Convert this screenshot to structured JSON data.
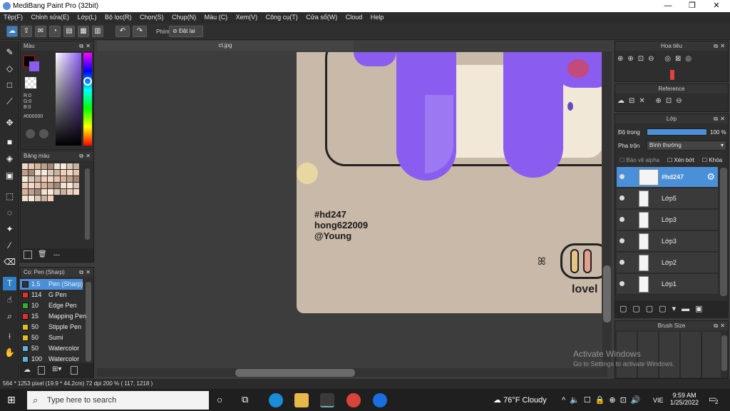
{
  "window": {
    "title": "MediBang Paint Pro (32bit)",
    "min": "—",
    "max": "❐",
    "close": "✕"
  },
  "menu": [
    "Tệp(F)",
    "Chỉnh sửa(E)",
    "Lớp(L)",
    "Bộ lọc(R)",
    "Chọn(S)",
    "Chụp(N)",
    "Màu (C)",
    "Xem(V)",
    "Công cụ(T)",
    "Cửa sổ(W)",
    "Cloud",
    "Help"
  ],
  "toolbar": {
    "keys_label": "Phím",
    "reset_label": "Đặt lại"
  },
  "color_panel": {
    "title": "Màu",
    "r": "R:0",
    "g": "G:0",
    "b": "B:0",
    "hex": "#000000"
  },
  "palette_panel": {
    "title": "Bảng màu",
    "footer": "---"
  },
  "brush_panel": {
    "title": "Cọ: Pen (Sharp)"
  },
  "brushes": [
    {
      "size": "1.5",
      "name": "Pen (Sharp)",
      "color": "#333333"
    },
    {
      "size": "114",
      "name": "G Pen",
      "color": "#e03030"
    },
    {
      "size": "10",
      "name": "Edge Pen",
      "color": "#30b030"
    },
    {
      "size": "15",
      "name": "Mapping Pen",
      "color": "#e03030"
    },
    {
      "size": "50",
      "name": "Stipple Pen",
      "color": "#e0c020"
    },
    {
      "size": "50",
      "name": "Sumi",
      "color": "#e0c020"
    },
    {
      "size": "50",
      "name": "Watercolor",
      "color": "#60b0e0"
    },
    {
      "size": "100",
      "name": "Watercolor",
      "color": "#60b0e0"
    }
  ],
  "document": {
    "tab": "ct.jpg"
  },
  "artwork": {
    "line1": "#hd247",
    "line2": "hong622009",
    "line3": "@Young",
    "corner_text": "lovel"
  },
  "navigator": {
    "title": "Hoa tiêu"
  },
  "reference": {
    "title": "Reference"
  },
  "layers_panel": {
    "title": "Lớp",
    "opacity_label": "Độ trong",
    "opacity_value": "100 %",
    "blend_label": "Pha trộn",
    "blend_value": "Bình thường",
    "protect_alpha": "Bảo vệ alpha",
    "clipping": "Xén bớt",
    "lock": "Khóa"
  },
  "layers": [
    {
      "name": "#hd247",
      "selected": true
    },
    {
      "name": "Lớp5",
      "selected": false
    },
    {
      "name": "Lớp3",
      "selected": false
    },
    {
      "name": "Lớp3",
      "selected": false
    },
    {
      "name": "Lớp2",
      "selected": false
    },
    {
      "name": "Lớp1",
      "selected": false
    }
  ],
  "brush_size_panel": {
    "title": "Brush Size"
  },
  "watermark": {
    "line1": "Activate Windows",
    "line2": "Go to Settings to activate Windows."
  },
  "status": {
    "text": "564 * 1253 pixel  (19.9 * 44.2cm)  72 dpi  200 %  ( 117, 1218 )"
  },
  "taskbar": {
    "search_placeholder": "Type here to search",
    "weather": "76°F  Cloudy",
    "lang": "VIE",
    "time": "9:59 AM",
    "date": "1/25/2022",
    "notifications": "2"
  },
  "colors": {
    "accent": "#4a90d9",
    "purple": "#8a5cf0",
    "canvas_bg": "#c9b9a8"
  }
}
